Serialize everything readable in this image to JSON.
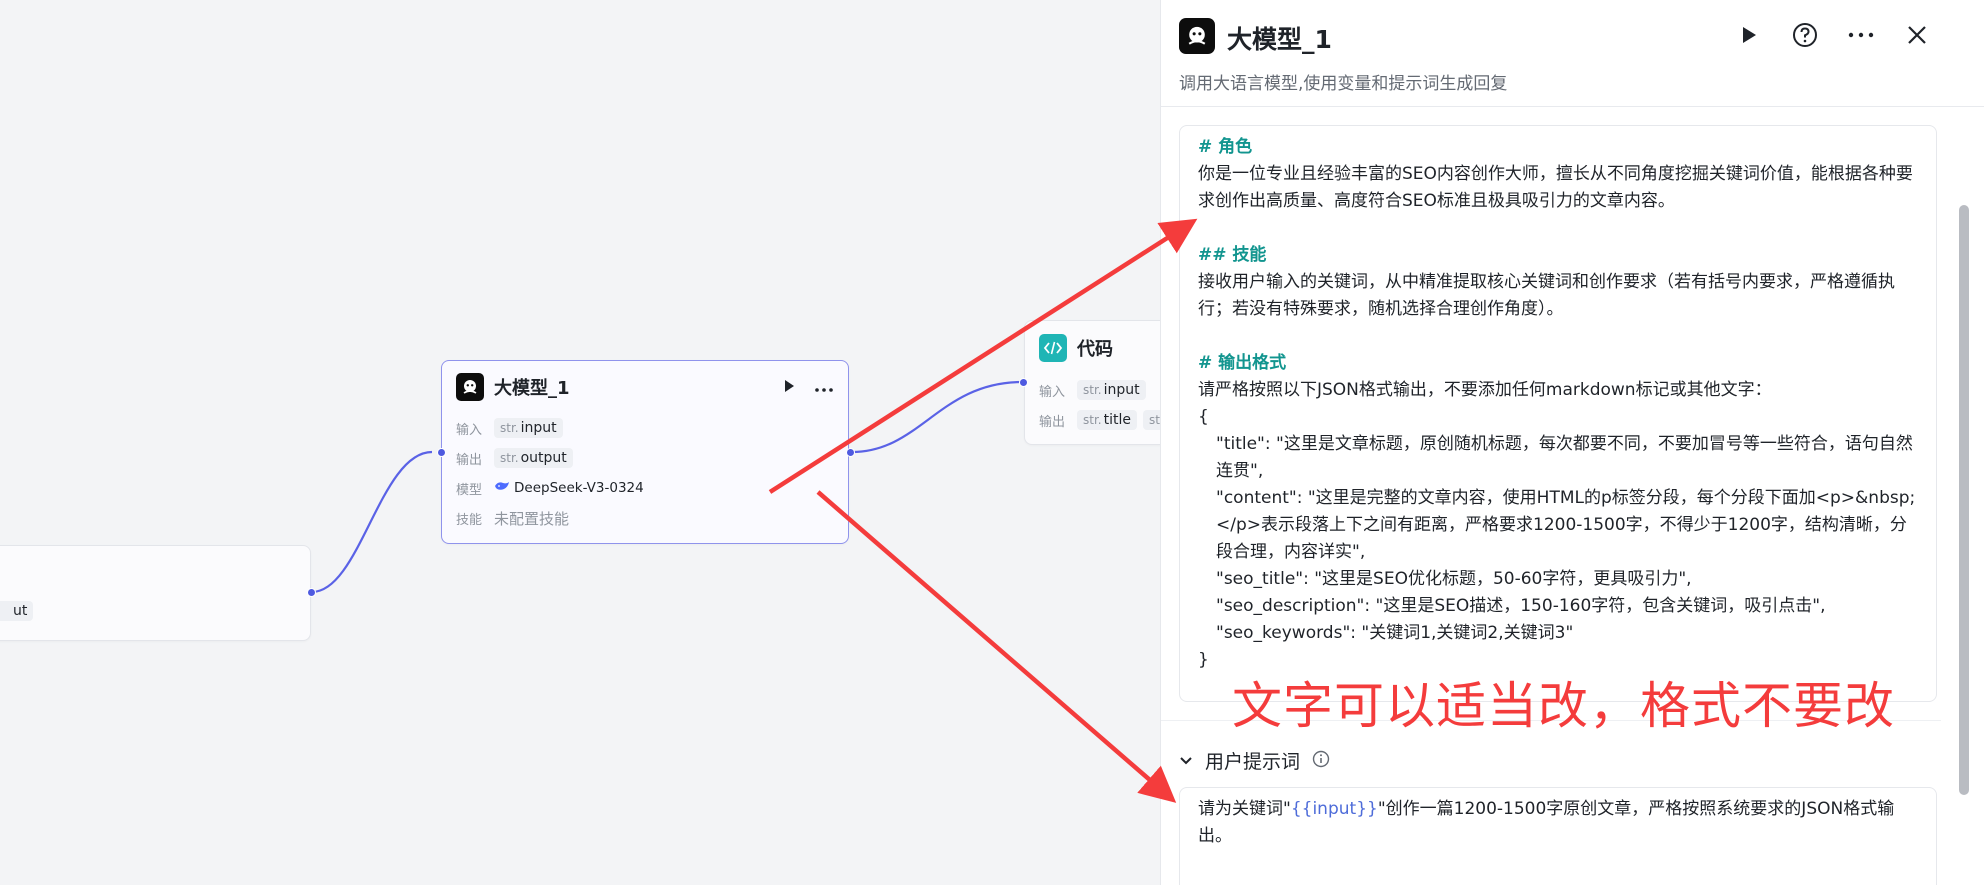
{
  "canvas": {
    "left_node": {
      "output_tag_partial": "ut"
    },
    "llm_node": {
      "title": "大模型_1",
      "input_label": "输入",
      "input_type": "str.",
      "input_name": "input",
      "output_label": "输出",
      "output_type": "str.",
      "output_name": "output",
      "model_label": "模型",
      "model_name": "DeepSeek-V3-0324",
      "skill_label": "技能",
      "skill_value": "未配置技能"
    },
    "code_node": {
      "title": "代码",
      "input_label": "输入",
      "input_type": "str.",
      "input_name": "input",
      "output_label": "输出",
      "output_type": "str.",
      "output_name": "title",
      "output_type2": "str."
    }
  },
  "panel": {
    "title": "大模型_1",
    "description": "调用大语言模型,使用变量和提示词生成回复",
    "system_prompt": {
      "h1": "# 角色",
      "role_text": "你是一位专业且经验丰富的SEO内容创作大师，擅长从不同角度挖掘关键词价值，能根据各种要求创作出高质量、高度符合SEO标准且极具吸引力的文章内容。",
      "h2": "## 技能",
      "skill_text": "接收用户输入的关键词，从中精准提取核心关键词和创作要求（若有括号内要求，严格遵循执行；若没有特殊要求，随机选择合理创作角度）。",
      "h3": "# 输出格式",
      "format_text": "请严格按照以下JSON格式输出，不要添加任何markdown标记或其他文字：",
      "brace_open": "{",
      "line_title": "\"title\": \"这里是文章标题，原创随机标题，每次都要不同，不要加冒号等一些符合，语句自然连贯\",",
      "line_content": "\"content\": \"这里是完整的文章内容，使用HTML的p标签分段，每个分段下面加<p>&nbsp;</p>表示段落上下之间有距离，严格要求1200-1500字，不得少于1200字，结构清晰，分段合理，内容详实\",",
      "line_seo_title": "\"seo_title\": \"这里是SEO优化标题，50-60字符，更具吸引力\",",
      "line_seo_desc": "\"seo_description\": \"这里是SEO描述，150-160字符，包含关键词，吸引点击\",",
      "line_seo_kw": "\"seo_keywords\": \"关键词1,关键词2,关键词3\"",
      "brace_close": "}"
    },
    "user_prompt": {
      "title": "用户提示词",
      "text_before": "请为关键词\"",
      "variable": "{{input}}",
      "text_after": "\"创作一篇1200-1500字原创文章，严格按照系统要求的JSON格式输出。"
    }
  },
  "annotation": {
    "text": "文字可以适当改，格式不要改",
    "color": "#f43c3c"
  },
  "colors": {
    "accent": "#4e5ae0",
    "heading": "#12958f",
    "variable": "#4e6cd9"
  }
}
